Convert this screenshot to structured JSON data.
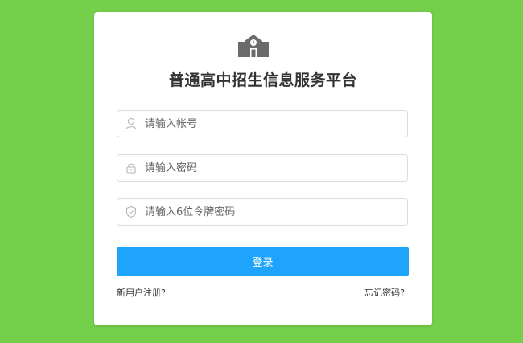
{
  "login": {
    "title": "普通高中招生信息服务平台",
    "account_placeholder": "请输入帐号",
    "password_placeholder": "请输入密码",
    "token_placeholder": "请输入6位令牌密码",
    "login_label": "登录",
    "register_link": "新用户注册?",
    "forgot_link": "忘记密码?"
  },
  "icons": {
    "logo": "school-building-icon",
    "account": "user-icon",
    "password": "lock-icon",
    "token": "shield-icon"
  },
  "colors": {
    "background": "#74cf4a",
    "card": "#ffffff",
    "primary_button": "#1fa4fb",
    "title_text": "#333333"
  }
}
